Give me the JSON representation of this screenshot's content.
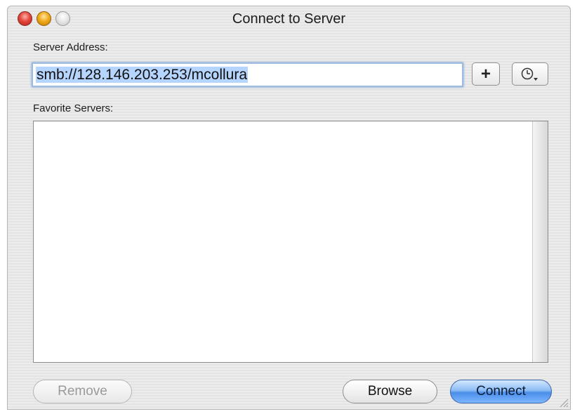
{
  "window": {
    "title": "Connect to Server"
  },
  "server_address": {
    "label": "Server Address:",
    "value": "smb://128.146.203.253/mcollura",
    "add_button": "+"
  },
  "favorites": {
    "label": "Favorite Servers:",
    "items": []
  },
  "buttons": {
    "remove": "Remove",
    "browse": "Browse",
    "connect": "Connect"
  },
  "icons": {
    "close": "close-icon",
    "minimize": "minimize-icon",
    "zoom": "zoom-icon",
    "recent": "clock-icon",
    "resize": "resize-grip-icon"
  },
  "colors": {
    "selection": "#b5d5ff",
    "default_button": "#4a8ee8",
    "focus_ring": "#6b9ad6"
  }
}
